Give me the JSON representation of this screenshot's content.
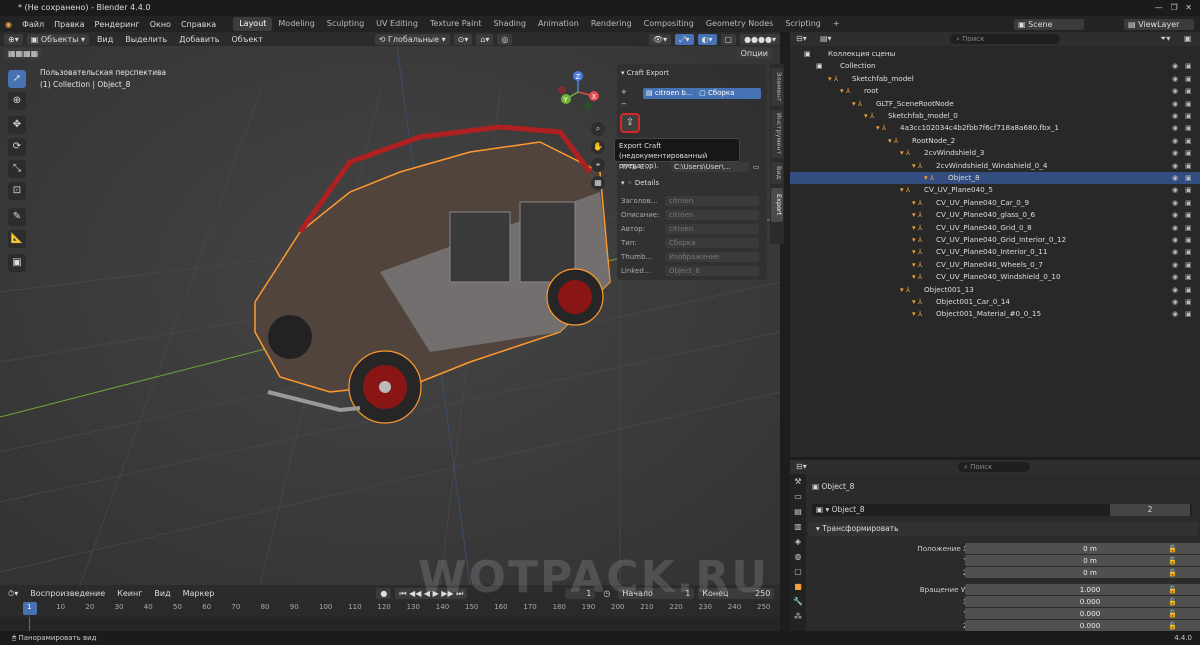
{
  "window": {
    "title": "* (Не сохранено) - Blender 4.4.0"
  },
  "menu": {
    "items": [
      "Файл",
      "Правка",
      "Рендеринг",
      "Окно",
      "Справка"
    ]
  },
  "workspaces": [
    "Layout",
    "Modeling",
    "Sculpting",
    "UV Editing",
    "Texture Paint",
    "Shading",
    "Animation",
    "Rendering",
    "Compositing",
    "Geometry Nodes",
    "Scripting",
    "+"
  ],
  "scene": {
    "name": "Scene",
    "view_layer": "ViewLayer"
  },
  "viewport": {
    "mode": "Объекты",
    "menus": [
      "Вид",
      "Выделить",
      "Добавить",
      "Объект"
    ],
    "transform_orientation": "Глобальные",
    "options_label": "Опции",
    "perspective_label": "Пользовательская перспектива",
    "collection_label": "(1) Collection | Object_8",
    "gizmo": {
      "x": "X",
      "y": "Y",
      "z": "Z"
    }
  },
  "npanel": {
    "tabs": [
      "Элемент",
      "Инструмент",
      "Вид",
      "Export"
    ],
    "craft_export_title": "Craft Export",
    "list_item_name": "citroen b...",
    "list_item_type": "Сборка",
    "path_label": "ПУТЬ E...",
    "path_value": "C:\\Users\\User\\...",
    "details_title": "Details",
    "fields": [
      {
        "label": "Заголов...",
        "value": "citroen"
      },
      {
        "label": "Описание:",
        "value": "citroen"
      },
      {
        "label": "Автор:",
        "value": "citroen"
      },
      {
        "label": "Тип:",
        "value": "Сборка"
      },
      {
        "label": "Thumb...",
        "value": "Изображение"
      },
      {
        "label": "Linked...",
        "value": "Object_8"
      }
    ]
  },
  "tooltip": {
    "title": "Export Craft",
    "subtitle": "(недокументированный оператор)."
  },
  "outliner": {
    "search_placeholder": "Поиск",
    "rows": [
      {
        "label": "Коллекция сцены",
        "indent": 0
      },
      {
        "label": "Collection",
        "indent": 1
      },
      {
        "label": "Sketchfab_model",
        "indent": 2
      },
      {
        "label": "root",
        "indent": 3
      },
      {
        "label": "GLTF_SceneRootNode",
        "indent": 4
      },
      {
        "label": "Sketchfab_model_0",
        "indent": 5
      },
      {
        "label": "4a3cc102034c4b2fbb7f6cf718a8a680.fbx_1",
        "indent": 6
      },
      {
        "label": "RootNode_2",
        "indent": 7
      },
      {
        "label": "2cvWindshield_3",
        "indent": 8
      },
      {
        "label": "2cvWindshield_Windshield_0_4",
        "indent": 9
      },
      {
        "label": "Object_8",
        "indent": 10,
        "selected": true
      },
      {
        "label": "CV_UV_Plane040_5",
        "indent": 8
      },
      {
        "label": "CV_UV_Plane040_Car_0_9",
        "indent": 9
      },
      {
        "label": "CV_UV_Plane040_glass_0_6",
        "indent": 9
      },
      {
        "label": "CV_UV_Plane040_Grid_0_8",
        "indent": 9
      },
      {
        "label": "CV_UV_Plane040_Grid_Interior_0_12",
        "indent": 9
      },
      {
        "label": "CV_UV_Plane040_Interior_0_11",
        "indent": 9
      },
      {
        "label": "CV_UV_Plane040_Wheels_0_7",
        "indent": 9
      },
      {
        "label": "CV_UV_Plane040_Windshield_0_10",
        "indent": 9
      },
      {
        "label": "Object001_13",
        "indent": 8
      },
      {
        "label": "Object001_Car_0_14",
        "indent": 9
      },
      {
        "label": "Object001_Material_#0_0_15",
        "indent": 9
      }
    ]
  },
  "properties": {
    "search_placeholder": "Поиск",
    "object_name": "Object_8",
    "data_name": "Object_8",
    "user_count": "2",
    "section": "Трансформировать",
    "location_label": "Положение X",
    "loc": {
      "x": "0 m",
      "y": "0 m",
      "z": "0 m"
    },
    "rotation_label": "Вращение W",
    "rot": {
      "w": "1.000",
      "x": "0.000",
      "y": "0.000",
      "z": "0.000"
    },
    "axis": {
      "x": "X",
      "y": "Y",
      "z": "Z"
    }
  },
  "timeline": {
    "menus": [
      "Воспроизведение",
      "Кеинг",
      "Вид",
      "Маркер"
    ],
    "current_frame": "1",
    "start_label": "Начало",
    "start": "1",
    "end_label": "Конец",
    "end": "250",
    "ticks": [
      "1",
      "10",
      "20",
      "30",
      "40",
      "50",
      "60",
      "70",
      "80",
      "90",
      "100",
      "110",
      "120",
      "130",
      "140",
      "150",
      "160",
      "170",
      "180",
      "190",
      "200",
      "210",
      "220",
      "230",
      "240",
      "250"
    ]
  },
  "status": {
    "text": "Панорамировать вид",
    "version": "4.4.0"
  },
  "watermark": "WOTPACK.RU"
}
